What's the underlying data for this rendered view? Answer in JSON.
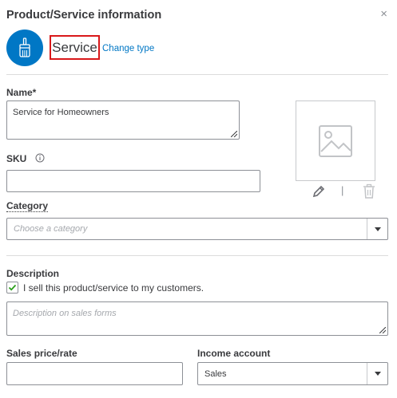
{
  "panel": {
    "title": "Product/Service information",
    "close_glyph": "×"
  },
  "type_selector": {
    "icon": "paintbrush-icon",
    "type_label": "Service",
    "change_type_link": "Change type",
    "accent_color": "#0077c5",
    "highlight_color": "#d9181a"
  },
  "form": {
    "name": {
      "label": "Name*",
      "value": "Service for Homeowners"
    },
    "sku": {
      "label": "SKU",
      "info_icon": "info-icon",
      "value": ""
    },
    "image": {
      "placeholder_icon": "image-placeholder-icon",
      "edit_icon": "pencil-icon",
      "separator": "|",
      "delete_icon": "trash-icon"
    },
    "category": {
      "label": "Category",
      "placeholder": "Choose a category"
    },
    "description": {
      "label": "Description",
      "sell_checkbox_checked": true,
      "sell_checkbox_label": "I sell this product/service to my customers.",
      "placeholder": "Description on sales forms"
    },
    "sales_price": {
      "label": "Sales price/rate",
      "value": ""
    },
    "income_account": {
      "label": "Income account",
      "selected": "Sales"
    }
  }
}
